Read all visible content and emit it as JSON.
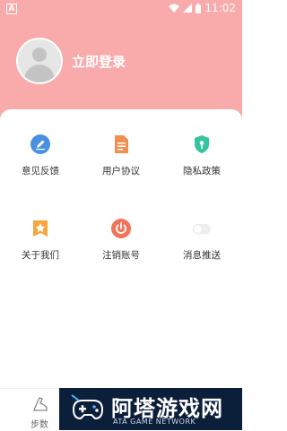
{
  "status_bar": {
    "left_indicator": "A",
    "time": "11:02"
  },
  "profile": {
    "login_label": "立即登录"
  },
  "menu": {
    "items": [
      {
        "label": "意见反馈",
        "icon": "feedback-pencil-icon",
        "color": "#4a90e2"
      },
      {
        "label": "用户协议",
        "icon": "document-icon",
        "color": "#f0904f"
      },
      {
        "label": "隐私政策",
        "icon": "shield-icon",
        "color": "#35c4a0"
      },
      {
        "label": "关于我们",
        "icon": "star-icon",
        "color": "#f6a63c"
      },
      {
        "label": "注销账号",
        "icon": "power-icon",
        "color": "#f2735a"
      },
      {
        "label": "消息推送",
        "icon": "toggle-switch",
        "toggle_on": false
      }
    ]
  },
  "bottom_nav": {
    "steps_label": "步数"
  },
  "watermark": {
    "title": "阿塔游戏网",
    "subtitle": "ATA GAME NETWORK"
  },
  "colors": {
    "header_bg": "#f9aaaa",
    "watermark_bg": "#0c1f3a"
  }
}
